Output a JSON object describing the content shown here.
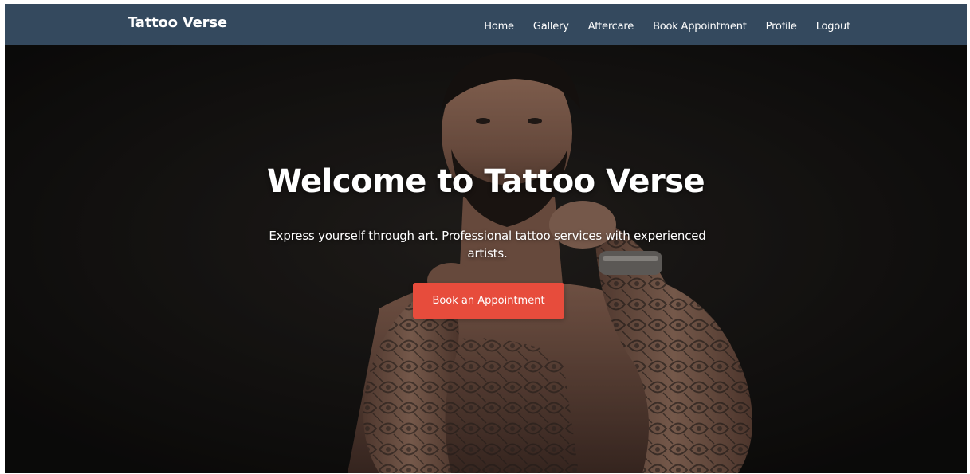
{
  "brand": "Tattoo Verse",
  "nav": {
    "items": [
      {
        "label": "Home"
      },
      {
        "label": "Gallery"
      },
      {
        "label": "Aftercare"
      },
      {
        "label": "Book Appointment"
      },
      {
        "label": "Profile"
      },
      {
        "label": "Logout"
      }
    ]
  },
  "hero": {
    "title": "Welcome to Tattoo Verse",
    "subtitle": "Express yourself through art. Professional tattoo services with experienced artists.",
    "cta_label": "Book an Appointment",
    "image": "tattooed-man-photo"
  },
  "colors": {
    "navbar": "#34495e",
    "accent": "#e74c3c",
    "hero_background": "#121110",
    "text": "#ffffff"
  }
}
